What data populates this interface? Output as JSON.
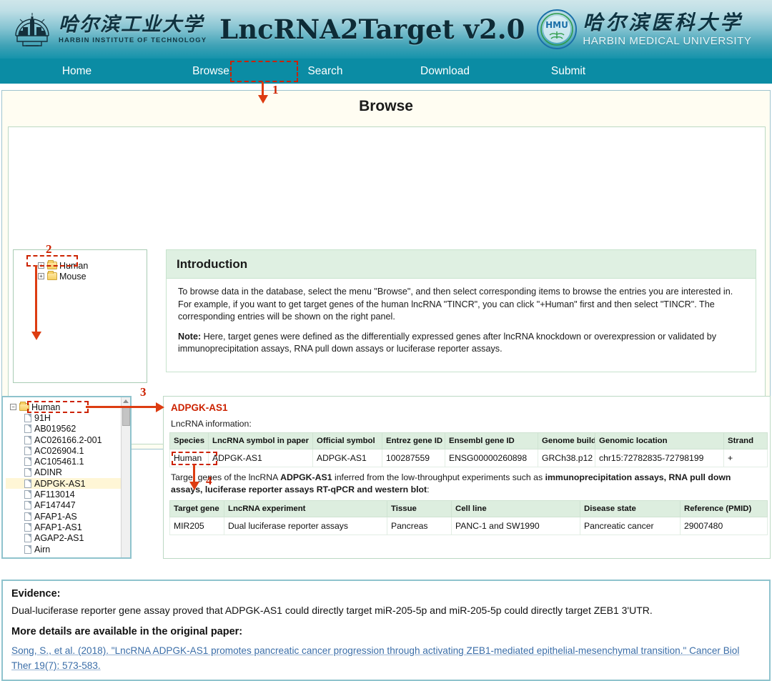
{
  "header": {
    "hit_logo": {
      "cn_name": "哈尔滨工业大学",
      "en_name": "HARBIN INSTITUTE OF TECHNOLOGY",
      "icon": "hit-crest-icon"
    },
    "site_title": "LncRNA2Target v2.0",
    "hmu_logo": {
      "cn_name": "哈尔滨医科大学",
      "en_name": "HARBIN MEDICAL UNIVERSITY",
      "monogram": "HMU",
      "icon": "hmu-crest-icon"
    },
    "gradient_top": "#cfe6ea",
    "gradient_bottom": "#1593ab"
  },
  "nav": {
    "items": [
      {
        "label": "Home"
      },
      {
        "label": "Browse"
      },
      {
        "label": "Search"
      },
      {
        "label": "Download"
      },
      {
        "label": "Submit"
      }
    ],
    "active": "Browse",
    "bar_color": "#0b8ca4"
  },
  "page": {
    "title": "Browse"
  },
  "species_tree": {
    "items": [
      {
        "label": "Human",
        "expander": "+",
        "icon": "folder-icon"
      },
      {
        "label": "Mouse",
        "expander": "+",
        "icon": "folder-icon"
      }
    ]
  },
  "introduction": {
    "heading": "Introduction",
    "paragraph1": "To browse data in the database, select the menu \"Browse\", and then select corresponding items to browse the entries you are interested in. For example, if you want to get target genes of the human lncRNA \"TINCR\", you can click \"+Human\" first and then select \"TINCR\". The corresponding entries will be shown on the right panel.",
    "note_label": "Note:",
    "note_text": " Here, target genes were defined as the differentially expressed genes after lncRNA knockdown or overexpression or validated by immunoprecipitation assays, RNA pull down assays or luciferase reporter assays."
  },
  "gene_tree": {
    "root": {
      "label": "Human",
      "expander": "−",
      "icon": "folder-icon"
    },
    "items": [
      {
        "label": "91H",
        "selected": false
      },
      {
        "label": "AB019562",
        "selected": false
      },
      {
        "label": "AC026166.2-001",
        "selected": false
      },
      {
        "label": "AC026904.1",
        "selected": false
      },
      {
        "label": "AC105461.1",
        "selected": false
      },
      {
        "label": "ADINR",
        "selected": false
      },
      {
        "label": "ADPGK-AS1",
        "selected": true
      },
      {
        "label": "AF113014",
        "selected": false
      },
      {
        "label": "AF147447",
        "selected": false
      },
      {
        "label": "AFAP1-AS",
        "selected": false
      },
      {
        "label": "AFAP1-AS1",
        "selected": false
      },
      {
        "label": "AGAP2-AS1",
        "selected": false
      },
      {
        "label": "Airn",
        "selected": false
      }
    ],
    "scrollbar": "vertical-scrollbar"
  },
  "result": {
    "gene_name": "ADPGK-AS1",
    "info_label": "LncRNA information:",
    "info_table": {
      "headers": [
        "Species",
        "LncRNA symbol in paper",
        "Official symbol",
        "Entrez gene ID",
        "Ensembl gene ID",
        "Genome build",
        "Genomic location",
        "Strand"
      ],
      "rows": [
        [
          "Human",
          "ADPGK-AS1",
          "ADPGK-AS1",
          "100287559",
          "ENSG00000260898",
          "GRCh38.p12",
          "chr15:72782835-72798199",
          "+"
        ]
      ]
    },
    "target_intro_parts": {
      "p1": "Target genes of the lncRNA ",
      "b1": "ADPGK-AS1",
      "p2": " inferred from the low-throughput experiments such as ",
      "b2": "immunoprecipitation assays, RNA pull down assays, luciferase reporter assays RT-qPCR and western blot",
      "p3": ":"
    },
    "target_table": {
      "headers": [
        "Target gene",
        "LncRNA experiment",
        "Tissue",
        "Cell line",
        "Disease state",
        "Reference (PMID)"
      ],
      "rows": [
        [
          "MIR205",
          "Dual luciferase reporter assays",
          "Pancreas",
          "PANC-1 and SW1990",
          "Pancreatic cancer",
          "29007480"
        ]
      ]
    }
  },
  "evidence": {
    "heading": "Evidence:",
    "text": "Dual-luciferase reporter gene assay proved that ADPGK-AS1 could directly target miR-205-5p and miR-205-5p could directly target ZEB1 3'UTR.",
    "more_heading": "More details are available in the original paper:",
    "citation_line1": "Song, S., et al. (2018). \"LncRNA ADPGK-AS1 promotes pancreatic cancer progression through activating ZEB1-mediated epithelial-mesenchymal transition.\"",
    "citation_line2": "Cancer Biol Ther 19(7): 573-583."
  },
  "annotations": {
    "color": "#dd3c11",
    "steps": [
      {
        "number": "1",
        "target": "Browse nav item"
      },
      {
        "number": "2",
        "target": "Human species folder"
      },
      {
        "number": "3",
        "target": "ADPGK-AS1 tree item"
      },
      {
        "number": "4",
        "target": "MIR205 target gene"
      }
    ]
  }
}
